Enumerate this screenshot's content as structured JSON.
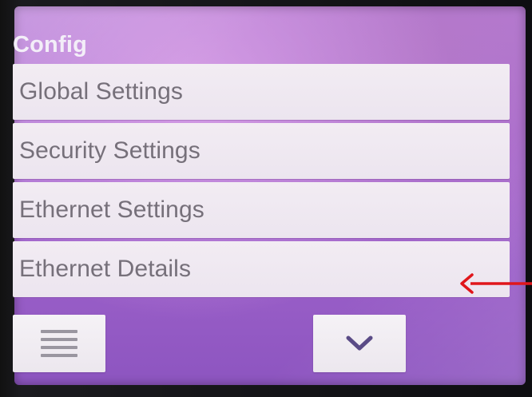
{
  "screen": {
    "title": "Config"
  },
  "menu": {
    "items": [
      {
        "label": "Global Settings"
      },
      {
        "label": "Security Settings"
      },
      {
        "label": "Ethernet Settings"
      },
      {
        "label": "Ethernet Details"
      }
    ]
  },
  "controls": {
    "menu_icon": "hamburger-icon",
    "down_icon": "chevron-down-icon"
  },
  "annotation": {
    "arrow_icon": "red-arrow-icon",
    "arrow_color": "#e0161b",
    "points_to": "Ethernet Details"
  },
  "colors": {
    "screen_bg": "#a86ad0",
    "item_bg": "#efe8f1",
    "item_text": "#76707a",
    "title_text": "#f3eef8"
  }
}
